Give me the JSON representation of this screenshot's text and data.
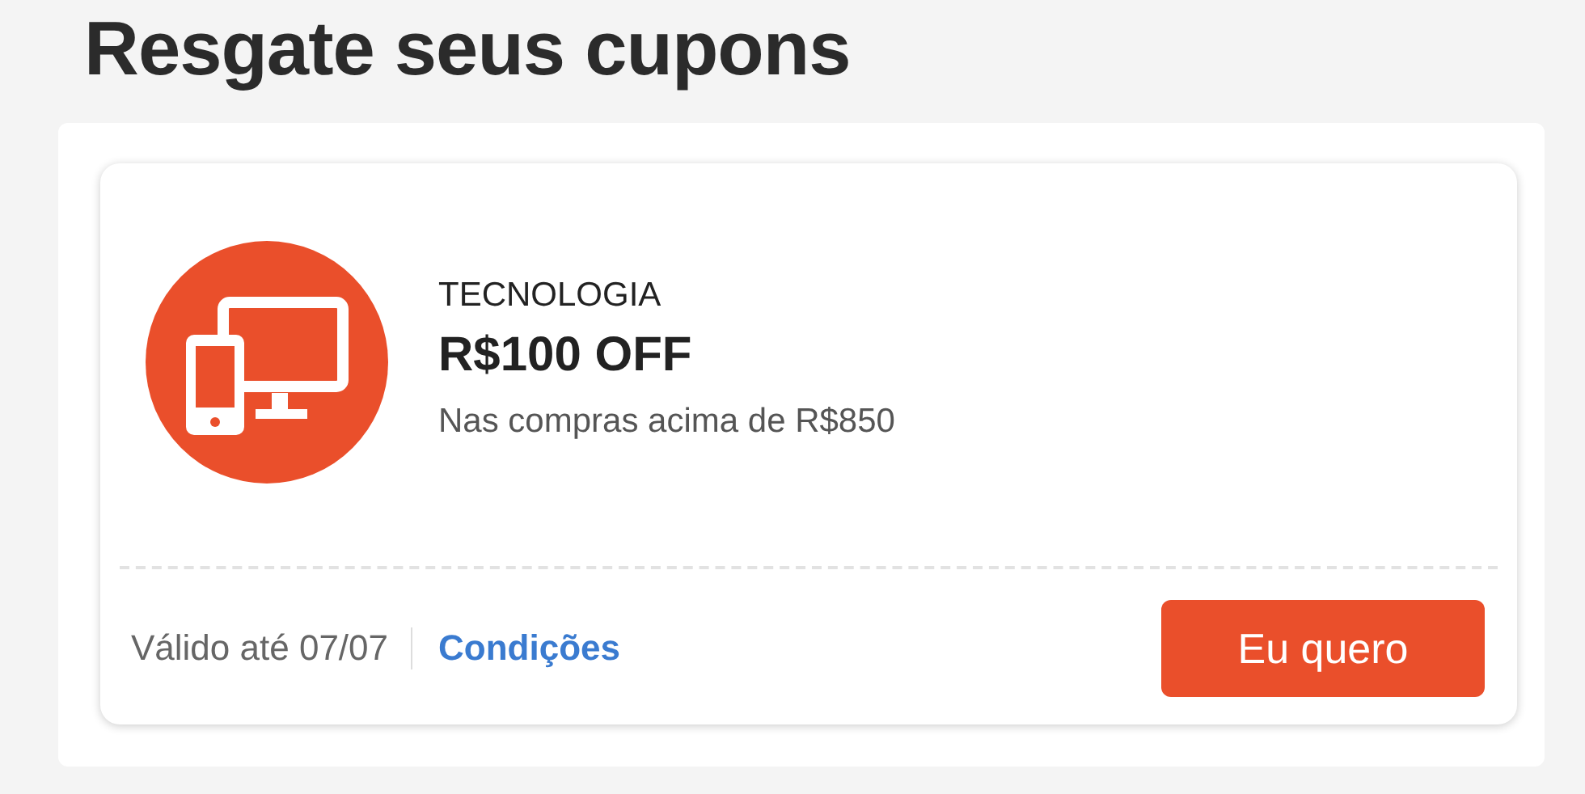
{
  "title": "Resgate seus cupons",
  "coupons": [
    {
      "category": "TECNOLOGIA",
      "discount": "R$100 OFF",
      "condition": "Nas compras acima de R$850",
      "validity": "Válido até 07/07",
      "link": "Condições",
      "button": "Eu quero"
    }
  ]
}
